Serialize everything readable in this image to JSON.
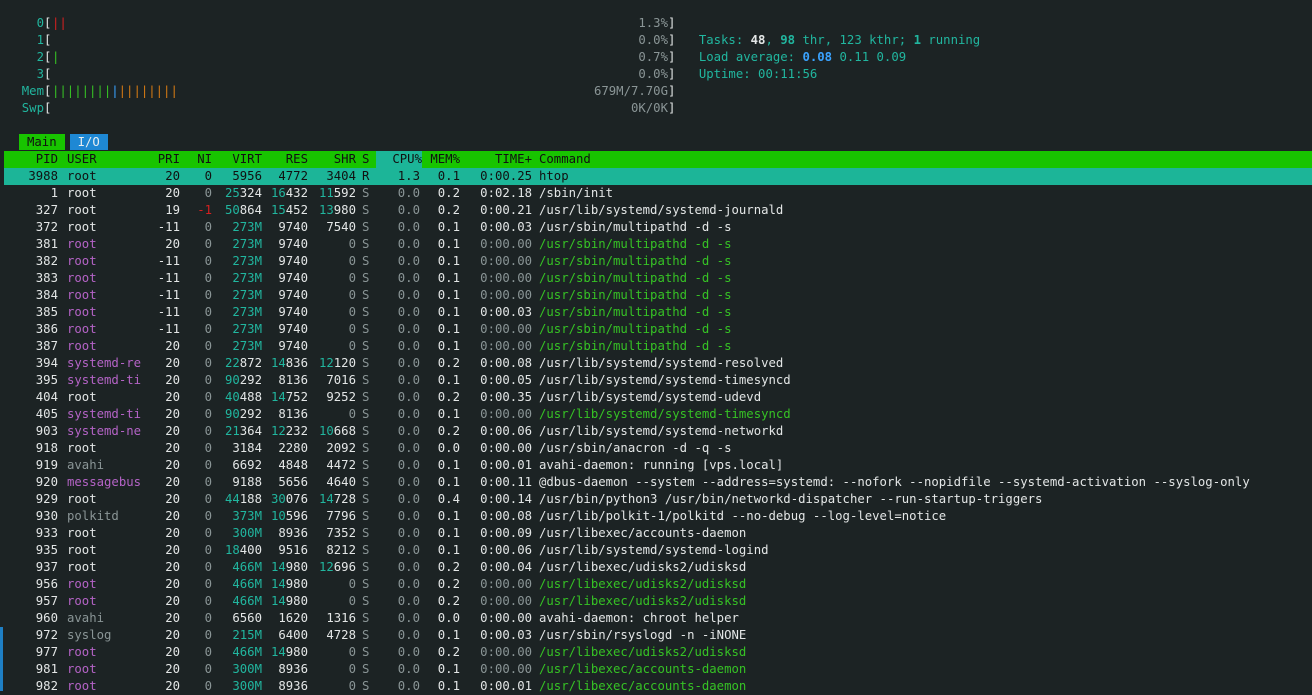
{
  "meters": {
    "cpus": [
      {
        "label": "0",
        "bars": [
          {
            "t": "||",
            "c": "red"
          }
        ],
        "value": "1.3%"
      },
      {
        "label": "1",
        "bars": [],
        "value": "0.0%"
      },
      {
        "label": "2",
        "bars": [
          {
            "t": "|",
            "c": "green"
          }
        ],
        "value": "0.7%"
      },
      {
        "label": "3",
        "bars": [],
        "value": "0.0%"
      }
    ],
    "mem": {
      "label": "Mem",
      "bars": [
        {
          "t": "||||||||",
          "c": "green"
        },
        {
          "t": "|",
          "c": "blue"
        },
        {
          "t": "||||||||",
          "c": "orange"
        }
      ],
      "value": "679M/7.70G"
    },
    "swp": {
      "label": "Swp",
      "bars": [],
      "value": "0K/0K"
    }
  },
  "summary": {
    "tasks_label": "Tasks: ",
    "tasks": "48",
    "thr": "98",
    "thr_label": " thr",
    "kthr": "123 kthr",
    "running": "1",
    "running_label": " running",
    "load_label": "Load average: ",
    "load1": "0.08",
    "load5": "0.11",
    "load15": "0.09",
    "uptime_label": "Uptime: ",
    "uptime": "00:11:56"
  },
  "tabs": [
    "Main",
    "I/O"
  ],
  "columns": {
    "pid": "PID",
    "user": "USER",
    "pri": "PRI",
    "ni": "NI",
    "virt": "VIRT",
    "res": "RES",
    "shr": "SHR",
    "s": "S",
    "cpu": "CPU%",
    "mem": "MEM%",
    "time": "TIME+",
    "cmd": "Command"
  },
  "colors": {
    "background": "#1c2324",
    "header_bg": "#18c400",
    "selected_bg": "#1cb598",
    "thread_user": "#b463c6",
    "thread_cmd": "#36c225",
    "teal": "#21b69f"
  },
  "processes": [
    {
      "pid": "3988",
      "user": "root",
      "pri": "20",
      "ni": "0",
      "virt": "5956",
      "res": "4772",
      "shr": "3404",
      "s": "R",
      "cpu": "1.3",
      "mem": "0.1",
      "time": "0:00.25",
      "cmd": "htop",
      "thread": false,
      "selected": true
    },
    {
      "pid": "1",
      "user": "root",
      "pri": "20",
      "ni": "0",
      "virt": "25324",
      "res": "16432",
      "shr": "11592",
      "s": "S",
      "cpu": "0.0",
      "mem": "0.2",
      "time": "0:02.18",
      "cmd": "/sbin/init",
      "thread": false
    },
    {
      "pid": "327",
      "user": "root",
      "pri": "19",
      "ni": "-1",
      "virt": "50864",
      "res": "15452",
      "shr": "13980",
      "s": "S",
      "cpu": "0.0",
      "mem": "0.2",
      "time": "0:00.21",
      "cmd": "/usr/lib/systemd/systemd-journald",
      "thread": false
    },
    {
      "pid": "372",
      "user": "root",
      "pri": "-11",
      "ni": "0",
      "virt": "273M",
      "res": "9740",
      "shr": "7540",
      "s": "S",
      "cpu": "0.0",
      "mem": "0.1",
      "time": "0:00.03",
      "cmd": "/usr/sbin/multipathd -d -s",
      "thread": false
    },
    {
      "pid": "381",
      "user": "root",
      "pri": "20",
      "ni": "0",
      "virt": "273M",
      "res": "9740",
      "shr": "0",
      "s": "S",
      "cpu": "0.0",
      "mem": "0.1",
      "time": "0:00.00",
      "cmd": "/usr/sbin/multipathd -d -s",
      "thread": true
    },
    {
      "pid": "382",
      "user": "root",
      "pri": "-11",
      "ni": "0",
      "virt": "273M",
      "res": "9740",
      "shr": "0",
      "s": "S",
      "cpu": "0.0",
      "mem": "0.1",
      "time": "0:00.00",
      "cmd": "/usr/sbin/multipathd -d -s",
      "thread": true
    },
    {
      "pid": "383",
      "user": "root",
      "pri": "-11",
      "ni": "0",
      "virt": "273M",
      "res": "9740",
      "shr": "0",
      "s": "S",
      "cpu": "0.0",
      "mem": "0.1",
      "time": "0:00.00",
      "cmd": "/usr/sbin/multipathd -d -s",
      "thread": true
    },
    {
      "pid": "384",
      "user": "root",
      "pri": "-11",
      "ni": "0",
      "virt": "273M",
      "res": "9740",
      "shr": "0",
      "s": "S",
      "cpu": "0.0",
      "mem": "0.1",
      "time": "0:00.00",
      "cmd": "/usr/sbin/multipathd -d -s",
      "thread": true
    },
    {
      "pid": "385",
      "user": "root",
      "pri": "-11",
      "ni": "0",
      "virt": "273M",
      "res": "9740",
      "shr": "0",
      "s": "S",
      "cpu": "0.0",
      "mem": "0.1",
      "time": "0:00.03",
      "cmd": "/usr/sbin/multipathd -d -s",
      "thread": true
    },
    {
      "pid": "386",
      "user": "root",
      "pri": "-11",
      "ni": "0",
      "virt": "273M",
      "res": "9740",
      "shr": "0",
      "s": "S",
      "cpu": "0.0",
      "mem": "0.1",
      "time": "0:00.00",
      "cmd": "/usr/sbin/multipathd -d -s",
      "thread": true
    },
    {
      "pid": "387",
      "user": "root",
      "pri": "20",
      "ni": "0",
      "virt": "273M",
      "res": "9740",
      "shr": "0",
      "s": "S",
      "cpu": "0.0",
      "mem": "0.1",
      "time": "0:00.00",
      "cmd": "/usr/sbin/multipathd -d -s",
      "thread": true
    },
    {
      "pid": "394",
      "user": "systemd-re",
      "pri": "20",
      "ni": "0",
      "virt": "22872",
      "res": "14836",
      "shr": "12120",
      "s": "S",
      "cpu": "0.0",
      "mem": "0.2",
      "time": "0:00.08",
      "cmd": "/usr/lib/systemd/systemd-resolved",
      "thread": false,
      "user_purple": true
    },
    {
      "pid": "395",
      "user": "systemd-ti",
      "pri": "20",
      "ni": "0",
      "virt": "90292",
      "res": "8136",
      "shr": "7016",
      "s": "S",
      "cpu": "0.0",
      "mem": "0.1",
      "time": "0:00.05",
      "cmd": "/usr/lib/systemd/systemd-timesyncd",
      "thread": false,
      "user_purple": true
    },
    {
      "pid": "404",
      "user": "root",
      "pri": "20",
      "ni": "0",
      "virt": "40488",
      "res": "14752",
      "shr": "9252",
      "s": "S",
      "cpu": "0.0",
      "mem": "0.2",
      "time": "0:00.35",
      "cmd": "/usr/lib/systemd/systemd-udevd",
      "thread": false
    },
    {
      "pid": "405",
      "user": "systemd-ti",
      "pri": "20",
      "ni": "0",
      "virt": "90292",
      "res": "8136",
      "shr": "0",
      "s": "S",
      "cpu": "0.0",
      "mem": "0.1",
      "time": "0:00.00",
      "cmd": "/usr/lib/systemd/systemd-timesyncd",
      "thread": true
    },
    {
      "pid": "903",
      "user": "systemd-ne",
      "pri": "20",
      "ni": "0",
      "virt": "21364",
      "res": "12232",
      "shr": "10668",
      "s": "S",
      "cpu": "0.0",
      "mem": "0.2",
      "time": "0:00.06",
      "cmd": "/usr/lib/systemd/systemd-networkd",
      "thread": false,
      "user_purple": true
    },
    {
      "pid": "918",
      "user": "root",
      "pri": "20",
      "ni": "0",
      "virt": "3184",
      "res": "2280",
      "shr": "2092",
      "s": "S",
      "cpu": "0.0",
      "mem": "0.0",
      "time": "0:00.00",
      "cmd": "/usr/sbin/anacron -d -q -s",
      "thread": false
    },
    {
      "pid": "919",
      "user": "avahi",
      "pri": "20",
      "ni": "0",
      "virt": "6692",
      "res": "4848",
      "shr": "4472",
      "s": "S",
      "cpu": "0.0",
      "mem": "0.1",
      "time": "0:00.01",
      "cmd": "avahi-daemon: running [vps.local]",
      "thread": false,
      "user_gray": true
    },
    {
      "pid": "920",
      "user": "messagebus",
      "pri": "20",
      "ni": "0",
      "virt": "9188",
      "res": "5656",
      "shr": "4640",
      "s": "S",
      "cpu": "0.0",
      "mem": "0.1",
      "time": "0:00.11",
      "cmd": "@dbus-daemon --system --address=systemd: --nofork --nopidfile --systemd-activation --syslog-only",
      "thread": false,
      "user_purple": true
    },
    {
      "pid": "929",
      "user": "root",
      "pri": "20",
      "ni": "0",
      "virt": "44188",
      "res": "30076",
      "shr": "14728",
      "s": "S",
      "cpu": "0.0",
      "mem": "0.4",
      "time": "0:00.14",
      "cmd": "/usr/bin/python3 /usr/bin/networkd-dispatcher --run-startup-triggers",
      "thread": false
    },
    {
      "pid": "930",
      "user": "polkitd",
      "pri": "20",
      "ni": "0",
      "virt": "373M",
      "res": "10596",
      "shr": "7796",
      "s": "S",
      "cpu": "0.0",
      "mem": "0.1",
      "time": "0:00.08",
      "cmd": "/usr/lib/polkit-1/polkitd --no-debug --log-level=notice",
      "thread": false,
      "user_gray": true
    },
    {
      "pid": "933",
      "user": "root",
      "pri": "20",
      "ni": "0",
      "virt": "300M",
      "res": "8936",
      "shr": "7352",
      "s": "S",
      "cpu": "0.0",
      "mem": "0.1",
      "time": "0:00.09",
      "cmd": "/usr/libexec/accounts-daemon",
      "thread": false
    },
    {
      "pid": "935",
      "user": "root",
      "pri": "20",
      "ni": "0",
      "virt": "18400",
      "res": "9516",
      "shr": "8212",
      "s": "S",
      "cpu": "0.0",
      "mem": "0.1",
      "time": "0:00.06",
      "cmd": "/usr/lib/systemd/systemd-logind",
      "thread": false
    },
    {
      "pid": "937",
      "user": "root",
      "pri": "20",
      "ni": "0",
      "virt": "466M",
      "res": "14980",
      "shr": "12696",
      "s": "S",
      "cpu": "0.0",
      "mem": "0.2",
      "time": "0:00.04",
      "cmd": "/usr/libexec/udisks2/udisksd",
      "thread": false
    },
    {
      "pid": "956",
      "user": "root",
      "pri": "20",
      "ni": "0",
      "virt": "466M",
      "res": "14980",
      "shr": "0",
      "s": "S",
      "cpu": "0.0",
      "mem": "0.2",
      "time": "0:00.00",
      "cmd": "/usr/libexec/udisks2/udisksd",
      "thread": true
    },
    {
      "pid": "957",
      "user": "root",
      "pri": "20",
      "ni": "0",
      "virt": "466M",
      "res": "14980",
      "shr": "0",
      "s": "S",
      "cpu": "0.0",
      "mem": "0.2",
      "time": "0:00.00",
      "cmd": "/usr/libexec/udisks2/udisksd",
      "thread": true
    },
    {
      "pid": "960",
      "user": "avahi",
      "pri": "20",
      "ni": "0",
      "virt": "6560",
      "res": "1620",
      "shr": "1316",
      "s": "S",
      "cpu": "0.0",
      "mem": "0.0",
      "time": "0:00.00",
      "cmd": "avahi-daemon: chroot helper",
      "thread": false,
      "user_gray": true
    },
    {
      "pid": "972",
      "user": "syslog",
      "pri": "20",
      "ni": "0",
      "virt": "215M",
      "res": "6400",
      "shr": "4728",
      "s": "S",
      "cpu": "0.0",
      "mem": "0.1",
      "time": "0:00.03",
      "cmd": "/usr/sbin/rsyslogd -n -iNONE",
      "thread": false,
      "user_gray": true
    },
    {
      "pid": "977",
      "user": "root",
      "pri": "20",
      "ni": "0",
      "virt": "466M",
      "res": "14980",
      "shr": "0",
      "s": "S",
      "cpu": "0.0",
      "mem": "0.2",
      "time": "0:00.00",
      "cmd": "/usr/libexec/udisks2/udisksd",
      "thread": true
    },
    {
      "pid": "981",
      "user": "root",
      "pri": "20",
      "ni": "0",
      "virt": "300M",
      "res": "8936",
      "shr": "0",
      "s": "S",
      "cpu": "0.0",
      "mem": "0.1",
      "time": "0:00.00",
      "cmd": "/usr/libexec/accounts-daemon",
      "thread": true
    },
    {
      "pid": "982",
      "user": "root",
      "pri": "20",
      "ni": "0",
      "virt": "300M",
      "res": "8936",
      "shr": "0",
      "s": "S",
      "cpu": "0.0",
      "mem": "0.1",
      "time": "0:00.01",
      "cmd": "/usr/libexec/accounts-daemon",
      "thread": true
    }
  ]
}
